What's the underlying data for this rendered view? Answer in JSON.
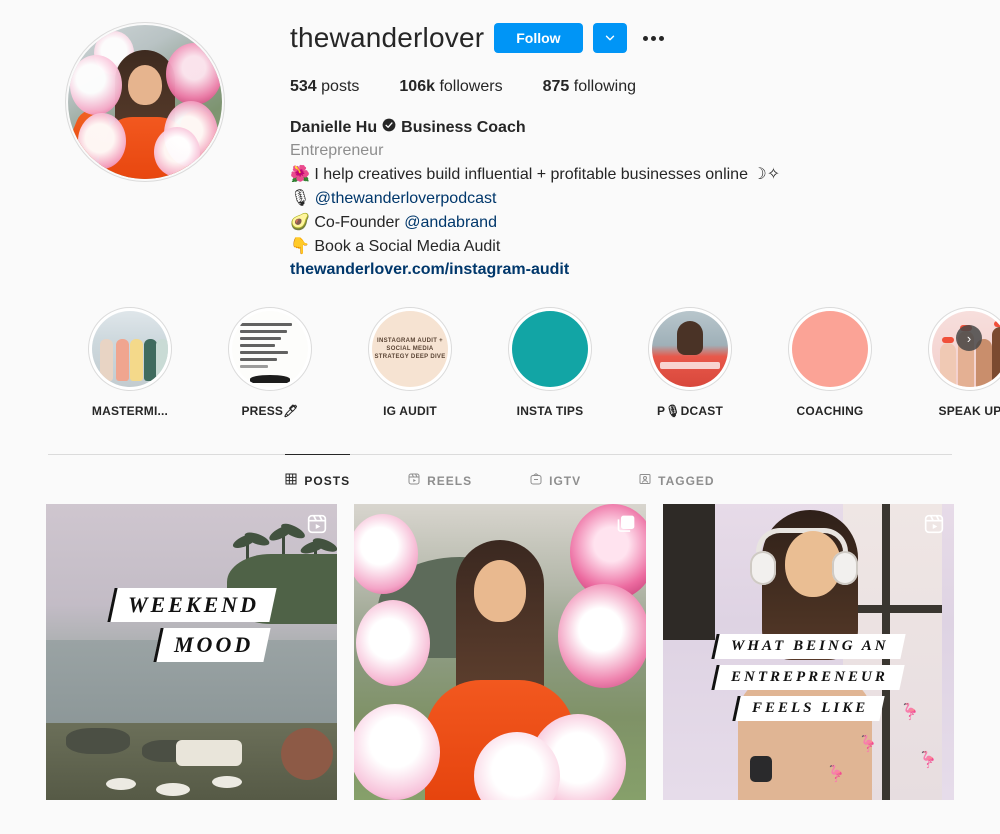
{
  "profile": {
    "username": "thewanderlover",
    "avatar_alt": "profile-photo",
    "follow_label": "Follow",
    "chevron_icon": "chevron-down-icon",
    "more_icon": "more-options-icon",
    "stats": [
      {
        "value": "534",
        "label": "posts"
      },
      {
        "value": "106k",
        "label": "followers"
      },
      {
        "value": "875",
        "label": "following"
      }
    ],
    "full_name": "Danielle Hu",
    "verified_icon": "verified-badge-icon",
    "title_suffix": "Business Coach",
    "category": "Entrepreneur",
    "bio_lines": [
      {
        "emoji": "🌺",
        "text": "I help creatives build influential + profitable businesses online ☽✧",
        "link": ""
      },
      {
        "emoji": "🎙",
        "text": "",
        "link": "@thewanderloverpodcast"
      },
      {
        "emoji": "🥑",
        "text": "Co-Founder ",
        "link": "@andabrand"
      },
      {
        "emoji": "👇",
        "text": "Book a Social Media Audit",
        "link": ""
      }
    ],
    "website": "thewanderlover.com/instagram-audit"
  },
  "highlights": {
    "next_icon": "›",
    "items": [
      {
        "label": "MASTERMI...",
        "art": "mastermind",
        "art_text": ""
      },
      {
        "label": "PRESS🖊",
        "art": "press",
        "art_text": "Danielle Hu of The Wanderlover: Five Ways To Leverage Instagram To Dramatically Improve Your Business"
      },
      {
        "label": "IG AUDIT",
        "art": "audit",
        "art_text": "INSTAGRAM AUDIT + SOCIAL MEDIA STRATEGY DEEP DIVE"
      },
      {
        "label": "INSTA TIPS",
        "art": "tips",
        "art_text": ""
      },
      {
        "label": "P🎙DCAST",
        "art": "podcast",
        "art_text": ""
      },
      {
        "label": "COACHING",
        "art": "coaching",
        "art_text": ""
      },
      {
        "label": "SPEAK UP",
        "art": "speak",
        "art_text": ""
      }
    ]
  },
  "tabs": [
    {
      "label": "POSTS",
      "icon": "grid-icon",
      "active": true
    },
    {
      "label": "REELS",
      "icon": "reels-icon",
      "active": false
    },
    {
      "label": "IGTV",
      "icon": "igtv-icon",
      "active": false
    },
    {
      "label": "TAGGED",
      "icon": "tagged-icon",
      "active": false
    }
  ],
  "posts": [
    {
      "art": "p1",
      "badge": "reels-icon",
      "caption": [
        "WEEKEND",
        "MOOD"
      ]
    },
    {
      "art": "p2",
      "badge": "carousel-icon",
      "caption": []
    },
    {
      "art": "p3",
      "badge": "reels-icon",
      "caption": [
        "WHAT BEING AN",
        "ENTREPRENEUR",
        "FEELS LIKE"
      ]
    }
  ],
  "colors": {
    "instagram_blue": "#0095f6",
    "link_navy": "#00376b",
    "muted_gray": "#8e8e8e",
    "text_dark": "#262626",
    "background": "#fafafa",
    "teal_highlight": "#12a5a5",
    "salmon_highlight": "#fba396"
  }
}
